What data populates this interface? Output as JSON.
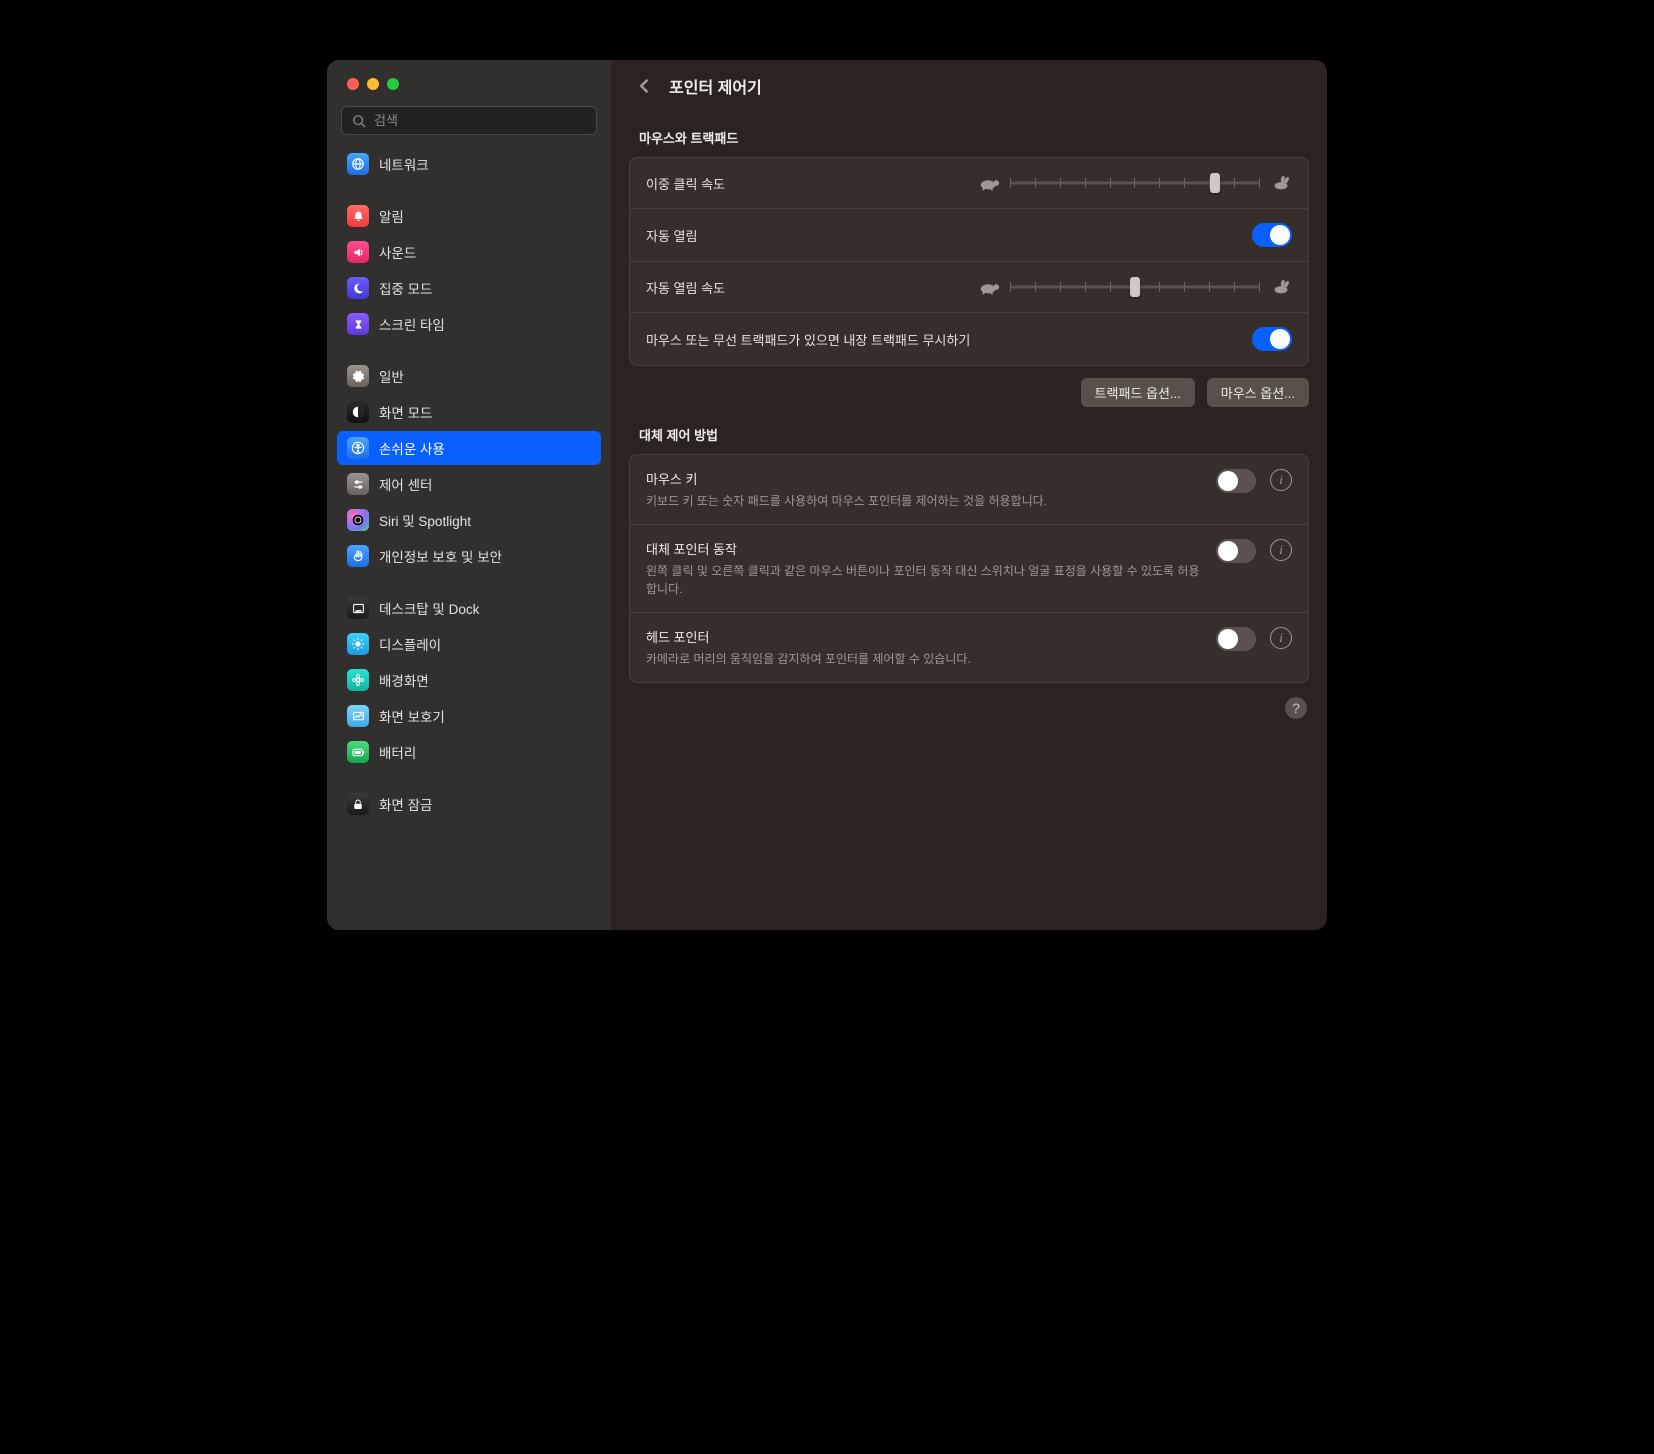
{
  "search": {
    "placeholder": "검색"
  },
  "sidebar": {
    "groups": [
      [
        {
          "label": "네트워크",
          "icon": "globe",
          "bg": "bg-blue"
        }
      ],
      [
        {
          "label": "알림",
          "icon": "bell",
          "bg": "bg-red"
        },
        {
          "label": "사운드",
          "icon": "sound",
          "bg": "bg-pink"
        },
        {
          "label": "집중 모드",
          "icon": "moon",
          "bg": "bg-indigo"
        },
        {
          "label": "스크린 타임",
          "icon": "hourglass",
          "bg": "bg-purple"
        }
      ],
      [
        {
          "label": "일반",
          "icon": "gear",
          "bg": "bg-gray"
        },
        {
          "label": "화면 모드",
          "icon": "appearance",
          "bg": "bg-dark"
        },
        {
          "label": "손쉬운 사용",
          "icon": "accessibility",
          "bg": "bg-blue",
          "selected": true
        },
        {
          "label": "제어 센터",
          "icon": "controls",
          "bg": "bg-gray"
        },
        {
          "label": "Siri 및 Spotlight",
          "icon": "siri",
          "bg": "bg-siri"
        },
        {
          "label": "개인정보 보호 및 보안",
          "icon": "hand",
          "bg": "bg-hand"
        }
      ],
      [
        {
          "label": "데스크탑 및 Dock",
          "icon": "dock",
          "bg": "bg-black"
        },
        {
          "label": "디스플레이",
          "icon": "sun",
          "bg": "bg-cyan"
        },
        {
          "label": "배경화면",
          "icon": "flower",
          "bg": "bg-teal"
        },
        {
          "label": "화면 보호기",
          "icon": "screensaver",
          "bg": "bg-lightblue"
        },
        {
          "label": "배터리",
          "icon": "battery",
          "bg": "bg-green"
        }
      ],
      [
        {
          "label": "화면 잠금",
          "icon": "lock",
          "bg": "bg-black"
        }
      ]
    ]
  },
  "page": {
    "title": "포인터 제어기",
    "sections": {
      "mouseTrackpad": {
        "title": "마우스와 트랙패드",
        "doubleClickSpeed": {
          "label": "이중 클릭 속도",
          "value": 0.82,
          "ticks": 11
        },
        "springLoading": {
          "label": "자동 열림",
          "on": true
        },
        "springLoadingSpeed": {
          "label": "자동 열림 속도",
          "value": 0.5,
          "ticks": 11
        },
        "ignoreBuiltIn": {
          "label": "마우스 또는 무선 트랙패드가 있으면 내장 트랙패드 무시하기",
          "on": true
        },
        "buttons": {
          "trackpadOptions": "트랙패드 옵션...",
          "mouseOptions": "마우스 옵션..."
        }
      },
      "altControl": {
        "title": "대체 제어 방법",
        "items": [
          {
            "title": "마우스 키",
            "desc": "키보드 키 또는 숫자 패드를 사용하여 마우스 포인터를 제어하는 것을 허용합니다.",
            "on": false
          },
          {
            "title": "대체 포인터 동작",
            "desc": "왼쪽 클릭 및 오른쪽 클릭과 같은 마우스 버튼이나 포인터 동작 대신 스위치나 얼굴 표정을 사용할 수 있도록 허용합니다.",
            "on": false
          },
          {
            "title": "헤드 포인터",
            "desc": "카메라로 머리의 움직임을 감지하여 포인터를 제어할 수 있습니다.",
            "on": false
          }
        ]
      }
    }
  }
}
